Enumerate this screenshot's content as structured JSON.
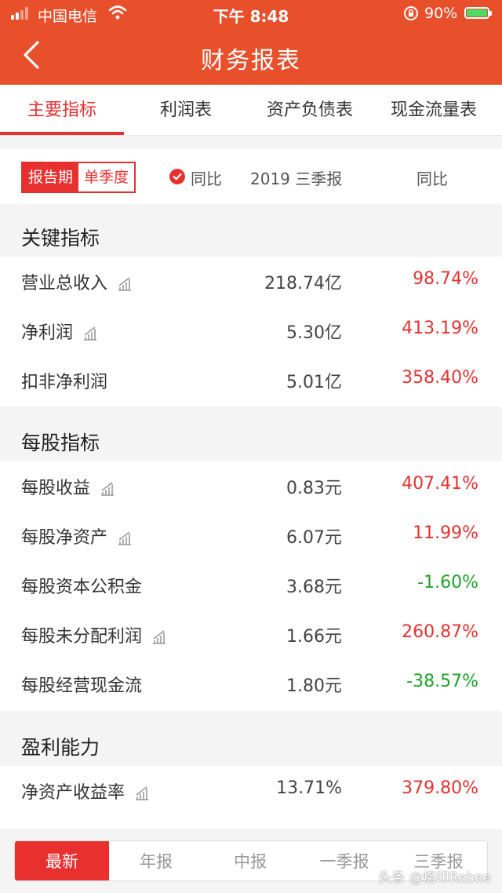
{
  "status_bar": {
    "carrier": "中国电信",
    "time": "下午 8:48",
    "battery": "90%"
  },
  "nav": {
    "title": "财务报表"
  },
  "tabs": [
    {
      "label": "主要指标",
      "active": true
    },
    {
      "label": "利润表",
      "active": false
    },
    {
      "label": "资产负债表",
      "active": false
    },
    {
      "label": "现金流量表",
      "active": false
    }
  ],
  "filter": {
    "seg_left": "报告期",
    "seg_right": "单季度",
    "yoy_toggle": "同比",
    "period": "2019 三季报",
    "yoy_header": "同比"
  },
  "sections": [
    {
      "title": "关键指标",
      "rows": [
        {
          "label": "营业总收入",
          "value": "218.74亿",
          "change": "98.74%",
          "trend": "up",
          "has_chart": true
        },
        {
          "label": "净利润",
          "value": "5.30亿",
          "change": "413.19%",
          "trend": "up",
          "has_chart": true
        },
        {
          "label": "扣非净利润",
          "value": "5.01亿",
          "change": "358.40%",
          "trend": "up",
          "has_chart": false
        }
      ]
    },
    {
      "title": "每股指标",
      "rows": [
        {
          "label": "每股收益",
          "value": "0.83元",
          "change": "407.41%",
          "trend": "up",
          "has_chart": true
        },
        {
          "label": "每股净资产",
          "value": "6.07元",
          "change": "11.99%",
          "trend": "up",
          "has_chart": true
        },
        {
          "label": "每股资本公积金",
          "value": "3.68元",
          "change": "-1.60%",
          "trend": "down",
          "has_chart": false
        },
        {
          "label": "每股未分配利润",
          "value": "1.66元",
          "change": "260.87%",
          "trend": "up",
          "has_chart": true
        },
        {
          "label": "每股经营现金流",
          "value": "1.80元",
          "change": "-38.57%",
          "trend": "down",
          "has_chart": false
        }
      ]
    },
    {
      "title": "盈利能力",
      "rows": [
        {
          "label": "净资产收益率",
          "value": "13.71%",
          "change": "379.80%",
          "trend": "up",
          "has_chart": true
        }
      ]
    }
  ],
  "bottom_tabs": [
    {
      "label": "最新",
      "active": true
    },
    {
      "label": "年报",
      "active": false
    },
    {
      "label": "中报",
      "active": false
    },
    {
      "label": "一季报",
      "active": false
    },
    {
      "label": "三季报",
      "active": false
    }
  ],
  "watermark": "头条 @烙印Rebee",
  "colors": {
    "brand": "#e8502c",
    "up": "#e8312f",
    "down": "#1fa22a"
  }
}
